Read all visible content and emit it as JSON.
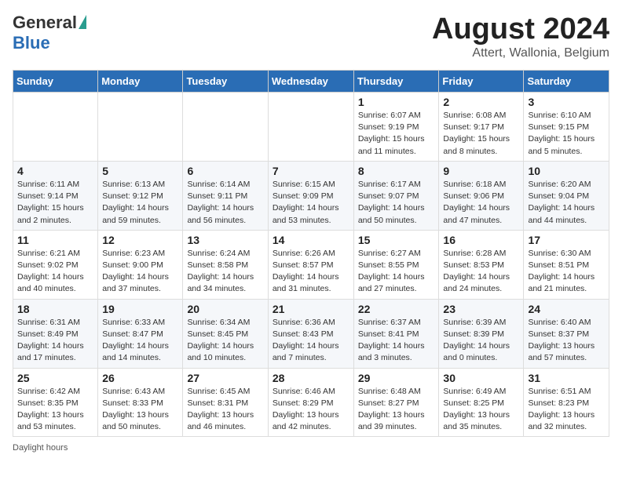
{
  "logo": {
    "general": "General",
    "blue": "Blue"
  },
  "title": "August 2024",
  "subtitle": "Attert, Wallonia, Belgium",
  "days_of_week": [
    "Sunday",
    "Monday",
    "Tuesday",
    "Wednesday",
    "Thursday",
    "Friday",
    "Saturday"
  ],
  "footer": "Daylight hours",
  "weeks": [
    [
      {
        "day": "",
        "info": ""
      },
      {
        "day": "",
        "info": ""
      },
      {
        "day": "",
        "info": ""
      },
      {
        "day": "",
        "info": ""
      },
      {
        "day": "1",
        "info": "Sunrise: 6:07 AM\nSunset: 9:19 PM\nDaylight: 15 hours\nand 11 minutes."
      },
      {
        "day": "2",
        "info": "Sunrise: 6:08 AM\nSunset: 9:17 PM\nDaylight: 15 hours\nand 8 minutes."
      },
      {
        "day": "3",
        "info": "Sunrise: 6:10 AM\nSunset: 9:15 PM\nDaylight: 15 hours\nand 5 minutes."
      }
    ],
    [
      {
        "day": "4",
        "info": "Sunrise: 6:11 AM\nSunset: 9:14 PM\nDaylight: 15 hours\nand 2 minutes."
      },
      {
        "day": "5",
        "info": "Sunrise: 6:13 AM\nSunset: 9:12 PM\nDaylight: 14 hours\nand 59 minutes."
      },
      {
        "day": "6",
        "info": "Sunrise: 6:14 AM\nSunset: 9:11 PM\nDaylight: 14 hours\nand 56 minutes."
      },
      {
        "day": "7",
        "info": "Sunrise: 6:15 AM\nSunset: 9:09 PM\nDaylight: 14 hours\nand 53 minutes."
      },
      {
        "day": "8",
        "info": "Sunrise: 6:17 AM\nSunset: 9:07 PM\nDaylight: 14 hours\nand 50 minutes."
      },
      {
        "day": "9",
        "info": "Sunrise: 6:18 AM\nSunset: 9:06 PM\nDaylight: 14 hours\nand 47 minutes."
      },
      {
        "day": "10",
        "info": "Sunrise: 6:20 AM\nSunset: 9:04 PM\nDaylight: 14 hours\nand 44 minutes."
      }
    ],
    [
      {
        "day": "11",
        "info": "Sunrise: 6:21 AM\nSunset: 9:02 PM\nDaylight: 14 hours\nand 40 minutes."
      },
      {
        "day": "12",
        "info": "Sunrise: 6:23 AM\nSunset: 9:00 PM\nDaylight: 14 hours\nand 37 minutes."
      },
      {
        "day": "13",
        "info": "Sunrise: 6:24 AM\nSunset: 8:58 PM\nDaylight: 14 hours\nand 34 minutes."
      },
      {
        "day": "14",
        "info": "Sunrise: 6:26 AM\nSunset: 8:57 PM\nDaylight: 14 hours\nand 31 minutes."
      },
      {
        "day": "15",
        "info": "Sunrise: 6:27 AM\nSunset: 8:55 PM\nDaylight: 14 hours\nand 27 minutes."
      },
      {
        "day": "16",
        "info": "Sunrise: 6:28 AM\nSunset: 8:53 PM\nDaylight: 14 hours\nand 24 minutes."
      },
      {
        "day": "17",
        "info": "Sunrise: 6:30 AM\nSunset: 8:51 PM\nDaylight: 14 hours\nand 21 minutes."
      }
    ],
    [
      {
        "day": "18",
        "info": "Sunrise: 6:31 AM\nSunset: 8:49 PM\nDaylight: 14 hours\nand 17 minutes."
      },
      {
        "day": "19",
        "info": "Sunrise: 6:33 AM\nSunset: 8:47 PM\nDaylight: 14 hours\nand 14 minutes."
      },
      {
        "day": "20",
        "info": "Sunrise: 6:34 AM\nSunset: 8:45 PM\nDaylight: 14 hours\nand 10 minutes."
      },
      {
        "day": "21",
        "info": "Sunrise: 6:36 AM\nSunset: 8:43 PM\nDaylight: 14 hours\nand 7 minutes."
      },
      {
        "day": "22",
        "info": "Sunrise: 6:37 AM\nSunset: 8:41 PM\nDaylight: 14 hours\nand 3 minutes."
      },
      {
        "day": "23",
        "info": "Sunrise: 6:39 AM\nSunset: 8:39 PM\nDaylight: 14 hours\nand 0 minutes."
      },
      {
        "day": "24",
        "info": "Sunrise: 6:40 AM\nSunset: 8:37 PM\nDaylight: 13 hours\nand 57 minutes."
      }
    ],
    [
      {
        "day": "25",
        "info": "Sunrise: 6:42 AM\nSunset: 8:35 PM\nDaylight: 13 hours\nand 53 minutes."
      },
      {
        "day": "26",
        "info": "Sunrise: 6:43 AM\nSunset: 8:33 PM\nDaylight: 13 hours\nand 50 minutes."
      },
      {
        "day": "27",
        "info": "Sunrise: 6:45 AM\nSunset: 8:31 PM\nDaylight: 13 hours\nand 46 minutes."
      },
      {
        "day": "28",
        "info": "Sunrise: 6:46 AM\nSunset: 8:29 PM\nDaylight: 13 hours\nand 42 minutes."
      },
      {
        "day": "29",
        "info": "Sunrise: 6:48 AM\nSunset: 8:27 PM\nDaylight: 13 hours\nand 39 minutes."
      },
      {
        "day": "30",
        "info": "Sunrise: 6:49 AM\nSunset: 8:25 PM\nDaylight: 13 hours\nand 35 minutes."
      },
      {
        "day": "31",
        "info": "Sunrise: 6:51 AM\nSunset: 8:23 PM\nDaylight: 13 hours\nand 32 minutes."
      }
    ]
  ]
}
